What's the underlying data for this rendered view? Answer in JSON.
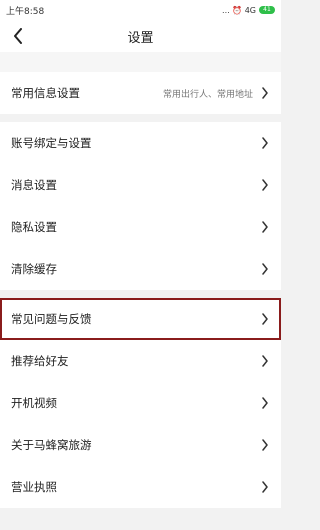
{
  "status": {
    "time": "上午8:58",
    "icons_text": "... ⏰ 4G",
    "battery": "41"
  },
  "header": {
    "title": "设置"
  },
  "sections": [
    {
      "items": [
        {
          "label": "常用信息设置",
          "hint": "常用出行人、常用地址"
        }
      ]
    },
    {
      "items": [
        {
          "label": "账号绑定与设置"
        },
        {
          "label": "消息设置"
        },
        {
          "label": "隐私设置"
        },
        {
          "label": "清除缓存"
        }
      ]
    },
    {
      "items": [
        {
          "label": "常见问题与反馈"
        },
        {
          "label": "推荐给好友"
        },
        {
          "label": "开机视频"
        },
        {
          "label": "关于马蜂窝旅游"
        },
        {
          "label": "营业执照"
        }
      ]
    }
  ],
  "colors": {
    "highlight_border": "#8a1c1c",
    "battery_green": "#2fbf4a"
  }
}
